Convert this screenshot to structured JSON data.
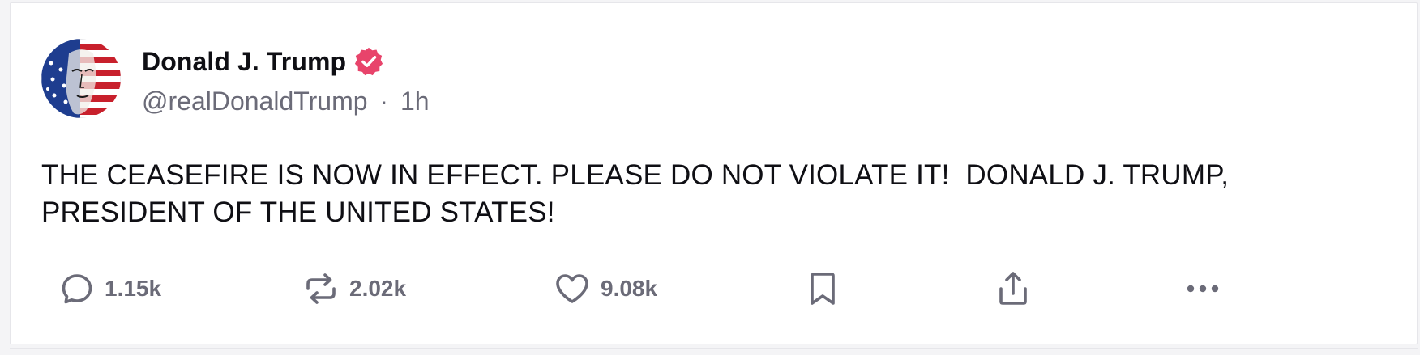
{
  "post": {
    "author": {
      "display_name": "Donald J. Trump",
      "handle": "@realDonaldTrump",
      "separator": "·",
      "time_ago": "1h",
      "verified": true,
      "verified_badge_color": "#e8446b",
      "avatar_icon": "flag-portrait-avatar"
    },
    "text": "THE CEASEFIRE IS NOW IN EFFECT. PLEASE DO NOT VIOLATE IT!  DONALD J. TRUMP,\nPRESIDENT OF THE UNITED STATES!"
  },
  "actions": {
    "reply": {
      "icon": "reply-icon",
      "count": "1.15k"
    },
    "repost": {
      "icon": "repost-icon",
      "count": "2.02k"
    },
    "like": {
      "icon": "heart-icon",
      "count": "9.08k"
    },
    "bookmark": {
      "icon": "bookmark-icon"
    },
    "share": {
      "icon": "share-icon"
    },
    "more": {
      "icon": "more-icon"
    }
  },
  "colors": {
    "text_primary": "#0f0f14",
    "text_secondary": "#6b6b78",
    "icon_gray": "#6b6b78",
    "card_border": "#e6e6ea"
  }
}
